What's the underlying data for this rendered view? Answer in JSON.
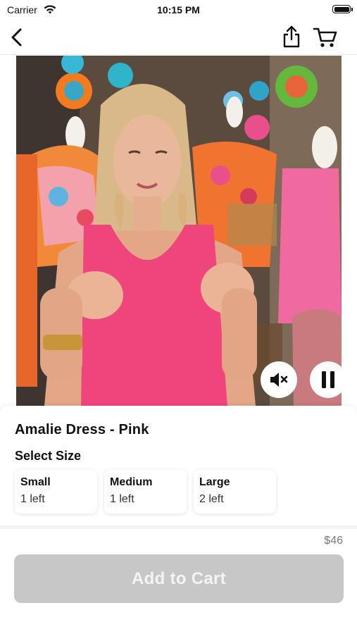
{
  "status_bar": {
    "carrier": "Carrier",
    "time": "10:15 PM"
  },
  "nav": {
    "icons": [
      "chevron-left-icon",
      "share-icon",
      "shopping-cart-icon"
    ]
  },
  "video": {
    "state": "playing",
    "muted": true,
    "controls": [
      "speaker-muted-icon",
      "pause-icon"
    ]
  },
  "product": {
    "title": "Amalie Dress - Pink",
    "size_heading": "Select Size",
    "sizes": [
      {
        "name": "Small",
        "stock": "1 left"
      },
      {
        "name": "Medium",
        "stock": "1 left"
      },
      {
        "name": "Large",
        "stock": "2 left"
      }
    ],
    "price": "$46"
  },
  "cta": {
    "label": "Add to Cart",
    "enabled": false
  },
  "colors": {
    "accent_disabled": "#c7c7c7",
    "top_pink": "#f0457c"
  }
}
